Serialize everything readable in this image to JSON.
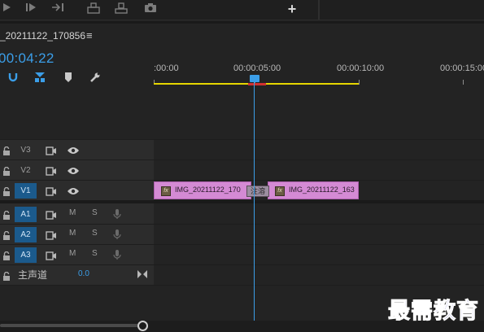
{
  "toolbar": {
    "icons": [
      "play-icon",
      "step-forward-icon",
      "go-to-out-icon",
      "insert-icon",
      "overwrite-icon",
      "camera-icon"
    ],
    "add_label": "+"
  },
  "sequence": {
    "name": "_20211122_170856",
    "menu_icon": "≡",
    "timecode": "00:04:22"
  },
  "ruler": {
    "labels": [
      ":00:00",
      "00:00:05:00",
      "00:00:10:00",
      "00:00:15:00"
    ]
  },
  "tracks": {
    "video": [
      {
        "label": "V3",
        "selected": false
      },
      {
        "label": "V2",
        "selected": false
      },
      {
        "label": "V1",
        "selected": true
      }
    ],
    "audio": [
      {
        "label": "A1",
        "m": "M",
        "s": "S"
      },
      {
        "label": "A2",
        "m": "M",
        "s": "S"
      },
      {
        "label": "A3",
        "m": "M",
        "s": "S"
      }
    ],
    "master": {
      "label": "主声道",
      "value": "0.0"
    }
  },
  "clips": [
    {
      "name": "IMG_20211122_170",
      "fx": "fx"
    },
    {
      "name": "IMG_20211122_163",
      "fx": "fx"
    }
  ],
  "transition": {
    "label": "注溶"
  },
  "watermark": "最需教育",
  "colors": {
    "accent_blue": "#3b9ee8",
    "clip_pink": "#d48ad4",
    "work_area_yellow": "#e6d600",
    "selected_track": "#1b5a8c"
  }
}
